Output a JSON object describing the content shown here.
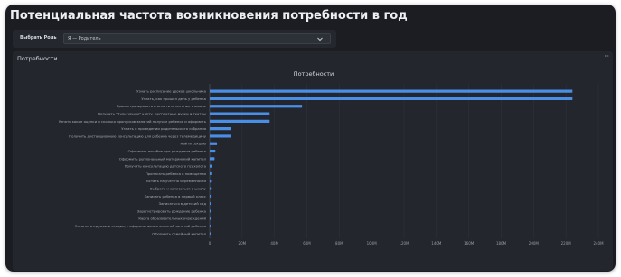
{
  "page": {
    "title": "Потенциальная частота возникновения потребности в год"
  },
  "filter": {
    "label": "Выбрать Роль",
    "value": "Я — Родитель",
    "icon": "chevron-down-icon"
  },
  "panel": {
    "title": "Потребности",
    "menu_icon": "more-horizontal-icon"
  },
  "colors": {
    "bar": "#4a8fe7",
    "background": "#1b1d22",
    "panel": "#23262c",
    "grid": "#2f333a"
  },
  "chart_data": {
    "type": "bar",
    "orientation": "horizontal",
    "title": "Потребности",
    "xlabel": "",
    "ylabel": "",
    "xlim": [
      0,
      2400000
    ],
    "grid": true,
    "legend": "none",
    "x_ticks": [
      "0",
      "20M",
      "40M",
      "60M",
      "80M",
      "100M",
      "120M",
      "140M",
      "160M",
      "180M",
      "200M",
      "220M",
      "240M"
    ],
    "categories": [
      "Узнать расписание уроков школьника",
      "Узнать, как прошел день у ребенка",
      "Проконтролировать и оплатить питание в школе",
      "Получить \"Культурную\" карту. Бесплатные музеи и театры",
      "Узнать какие оценки и сколько пропусков занятий получил ребенок и оформить",
      "Узнать о проведении родительского собрания",
      "Получить дистанционную консультацию для ребенка через телемедицину",
      "Найти секцию",
      "Оформить пособие при рождении ребенка",
      "Оформить региональный материнский капитал",
      "Получить консультацию детского психолога",
      "Прописать ребенка в помещении",
      "Встать на учет по беременности",
      "Выбрать и записаться в школу",
      "Записать ребенка в первый класс",
      "Записаться в детский сад",
      "Зарегистрировать рождение ребенка",
      "Карта образовательных учреждений",
      "Оплатить кружки и секции, с оформлением и оплатой занятий ребенка",
      "Оформить семейный капитал"
    ],
    "values": [
      2240000,
      2240000,
      570000,
      370000,
      370000,
      130000,
      130000,
      45000,
      35000,
      30000,
      12000,
      10000,
      8000,
      7000,
      6000,
      5000,
      4000,
      3000,
      2000,
      1500
    ]
  }
}
